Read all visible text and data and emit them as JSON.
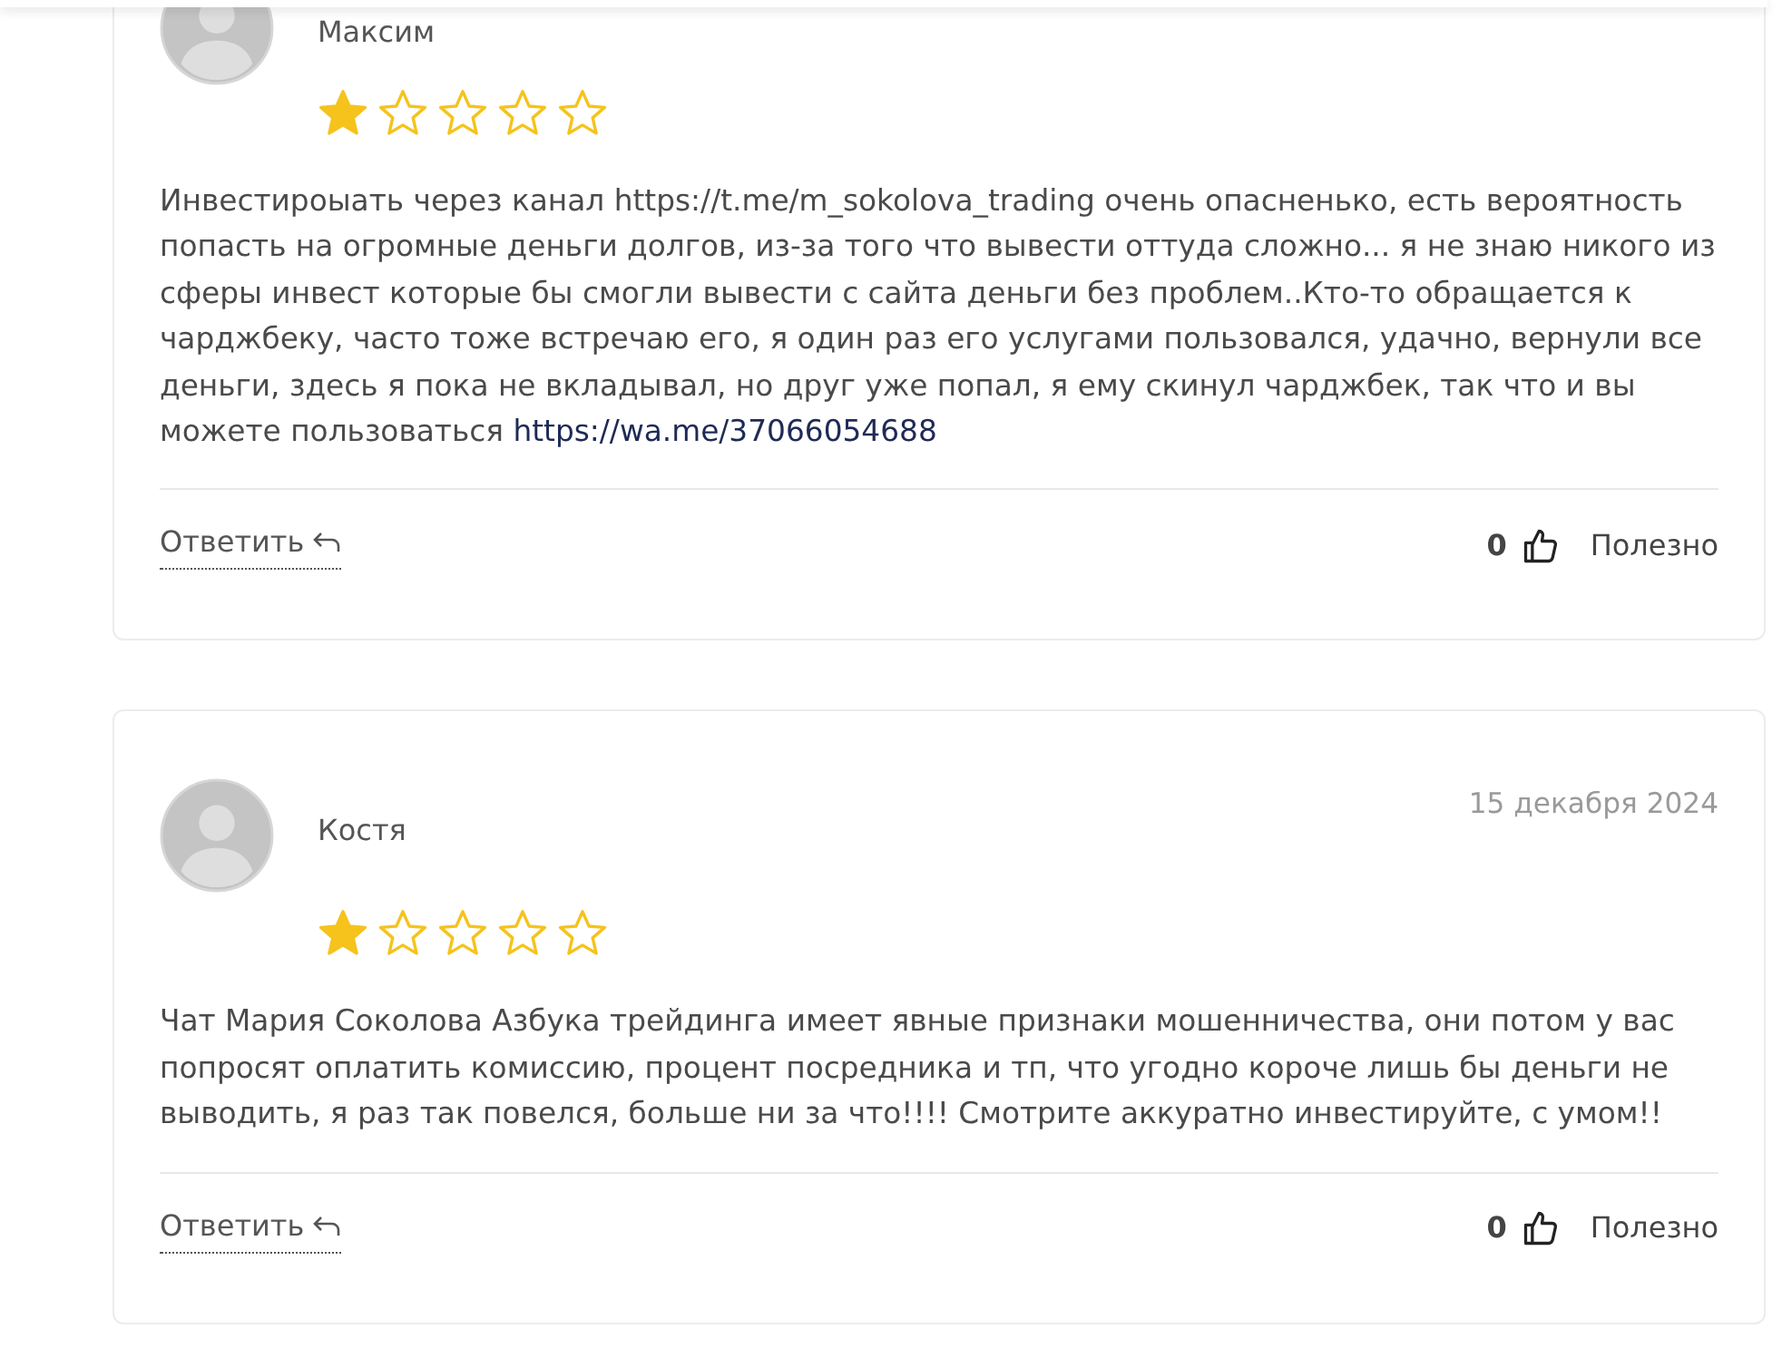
{
  "reviews": [
    {
      "author": "Максим",
      "stars": 1,
      "body": [
        {
          "kind": "text",
          "text": "Инвестироыать через канал https://t.me/m_sokolova_trading очень опасненько, есть вероятность попасть на огромные деньги долгов, из-за того что вывести оттуда сложно... я не знаю никого из сферы инвест которые бы смогли вывести с сайта деньги без проблем..Кто-то обращается к чарджбеку, часто тоже встречаю его, я один раз его услугами пользовался, удачно, вернули все деньги, здесь я пока не вкладывал, но друг уже попал, я ему скинул чарджбек, так что и вы можете пользоваться "
        },
        {
          "kind": "link",
          "text": "https://wa.me/37066054688"
        }
      ],
      "reply": "Ответить",
      "likes": "0",
      "helpful": "Полезно"
    },
    {
      "author": "Костя",
      "date": "15 декабря 2024",
      "stars": 1,
      "body": [
        {
          "kind": "text",
          "text": "Чат Мария Соколова Азбука трейдинга имеет явные признаки мошенничества, они потом у вас попросят оплатить комиссию, процент посредника и тп, что угодно короче лишь бы деньги не выводить, я раз так повелся, больше ни за что!!!! Смотрите аккуратно инвестируйте, с умом!!"
        }
      ],
      "reply": "Ответить",
      "likes": "0",
      "helpful": "Полезно"
    }
  ]
}
